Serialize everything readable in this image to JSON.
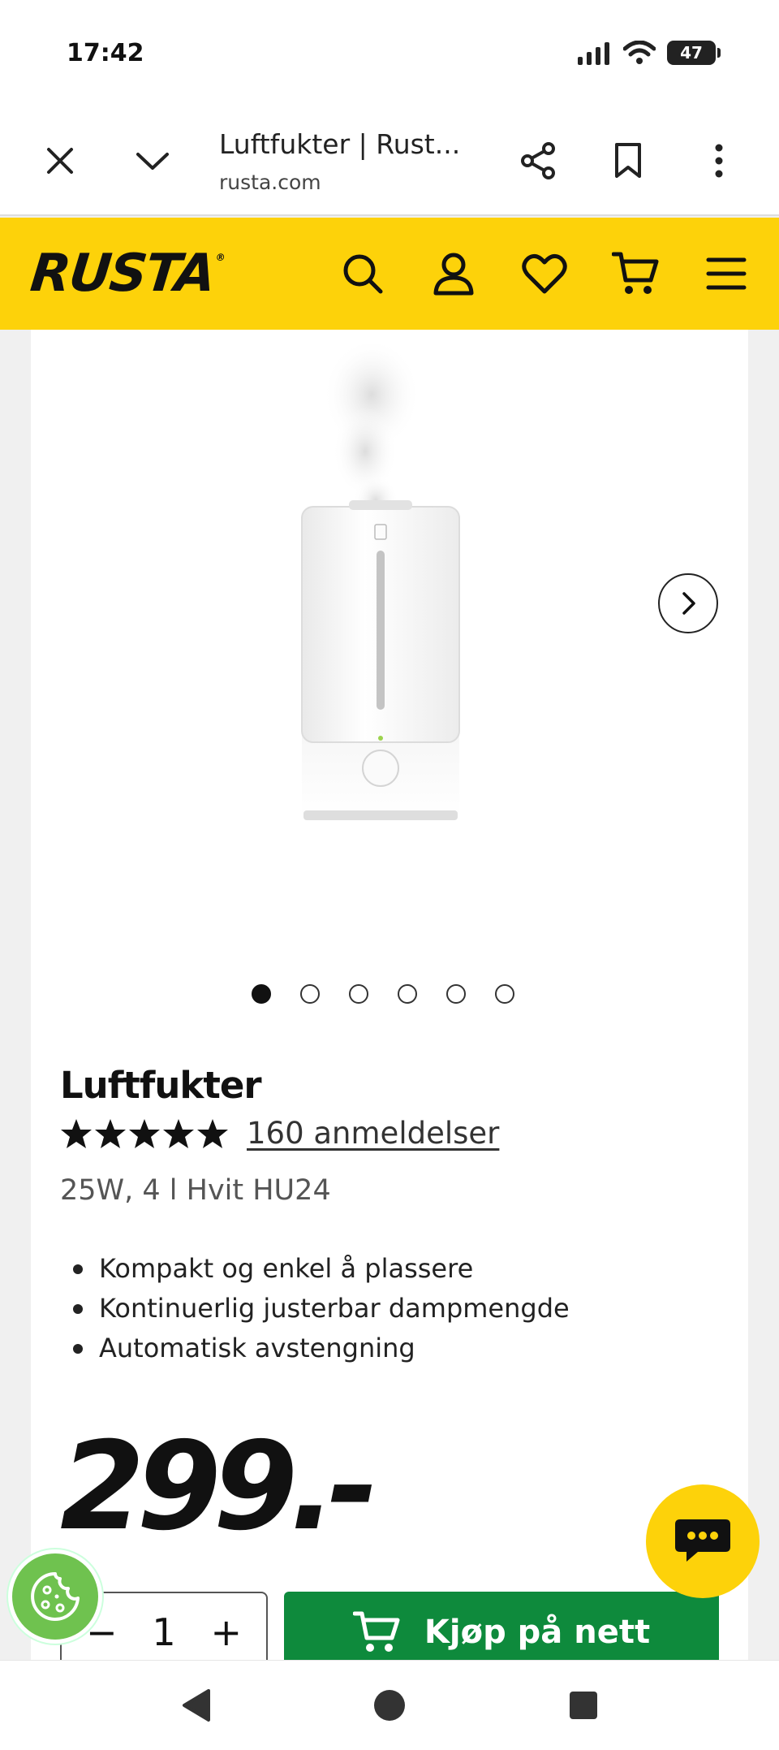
{
  "status_bar": {
    "time": "17:42",
    "battery": "47",
    "icons": [
      "signal-icon",
      "wifi-icon",
      "battery-icon"
    ]
  },
  "browser": {
    "page_title": "Luftfukter | Rust...",
    "domain": "rusta.com",
    "icons": [
      "close-icon",
      "chevron-down-icon",
      "share-icon",
      "bookmark-icon",
      "more-vertical-icon"
    ]
  },
  "header": {
    "logo": "RUSTA",
    "logo_mark": "®",
    "icons": [
      "search-icon",
      "account-icon",
      "heart-icon",
      "cart-icon",
      "menu-icon"
    ],
    "background": "#fdd20a"
  },
  "gallery": {
    "image_count": 6,
    "active_index": 0
  },
  "product": {
    "name": "Luftfukter",
    "rating": 5,
    "reviews": "160 anmeldelser",
    "variant": "25W, 4 l Hvit HU24",
    "features": [
      "Kompakt og enkel å plassere",
      "Kontinuerlig justerbar dampmengde",
      "Automatisk avstengning"
    ],
    "price": "299.-"
  },
  "purchase": {
    "qty_minus": "−",
    "qty_value": "1",
    "qty_plus": "+",
    "buy_label": "Kjøp på nett",
    "buy_color": "#0e8a3c"
  },
  "floating": {
    "chat_icon": "chat-bubble-icon",
    "cookie_icon": "cookie-icon"
  },
  "nav": {
    "icons": [
      "back-icon",
      "home-icon",
      "recents-icon"
    ]
  }
}
